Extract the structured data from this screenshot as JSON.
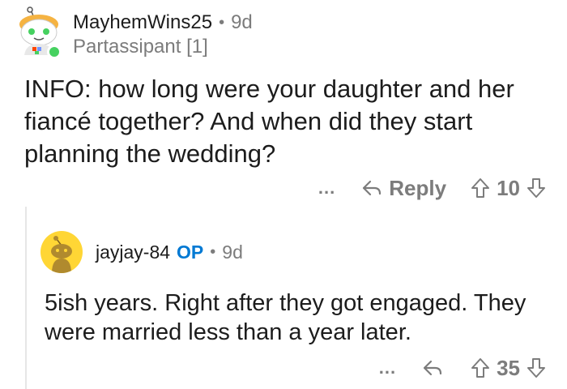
{
  "comment": {
    "username": "MayhemWins25",
    "age": "9d",
    "flair": "Partassipant [1]",
    "body": "INFO: how long were your daughter and her fiancé together? And when did they start planning the wedding?",
    "reply_label": "Reply",
    "more_label": "...",
    "score": "10",
    "online_color": "#46d160"
  },
  "reply": {
    "username": "jayjay-84",
    "op_label": "OP",
    "age": "9d",
    "body": "5ish years. Right after they got engaged. They were married less than a year later.",
    "more_label": "...",
    "score": "35",
    "avatar_color": "#ffd635",
    "op_color": "#0079d3"
  },
  "separator": "•"
}
